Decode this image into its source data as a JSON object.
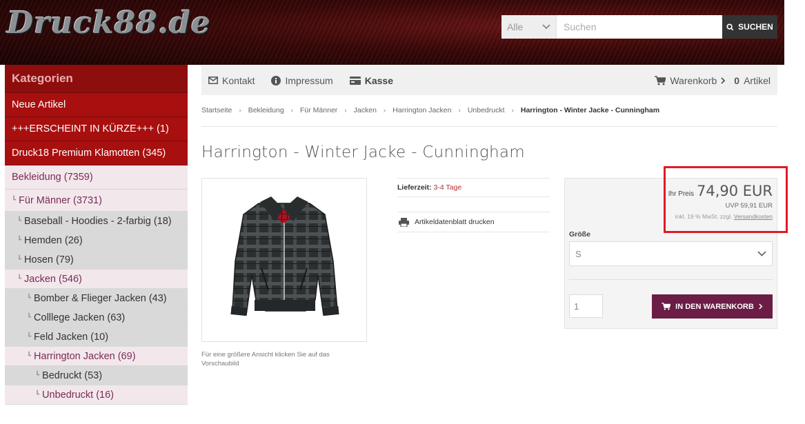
{
  "header": {
    "logo_text": "Druck88.de",
    "search": {
      "scope_label": "Alle",
      "placeholder": "Suchen",
      "button_label": "SUCHEN"
    }
  },
  "sidebar": {
    "heading": "Kategorien",
    "items": [
      {
        "label": "Neue Artikel"
      },
      {
        "label": "+++ERSCHEINT IN KÜRZE+++ (1)"
      },
      {
        "label": "Druck18 Premium Klamotten (345)"
      },
      {
        "label": "Bekleidung (7359)"
      },
      {
        "label": "Für Männer (3731)"
      },
      {
        "label": "Baseball - Hoodies - 2-farbig (18)"
      },
      {
        "label": "Hemden (26)"
      },
      {
        "label": "Hosen (79)"
      },
      {
        "label": "Jacken (546)"
      },
      {
        "label": "Bomber & Flieger Jacken (43)"
      },
      {
        "label": "Colllege Jacken (63)"
      },
      {
        "label": "Feld Jacken (10)"
      },
      {
        "label": "Harrington Jacken (69)"
      },
      {
        "label": "Bedruckt (53)"
      },
      {
        "label": "Unbedruckt (16)"
      }
    ]
  },
  "topnav": {
    "kontakt": "Kontakt",
    "impressum": "Impressum",
    "kasse": "Kasse",
    "warenkorb": "Warenkorb",
    "cart_count": "0",
    "cart_unit": "Artikel"
  },
  "breadcrumb": [
    "Startseite",
    "Bekleidung",
    "Für Männer",
    "Jacken",
    "Harrington Jacken",
    "Unbedruckt",
    "Harrington - Winter Jacke - Cunningham"
  ],
  "product": {
    "title": "Harrington - Winter Jacke - Cunningham",
    "image_note": "Für eine größere Ansicht klicken Sie auf das Vorschaubild",
    "delivery_label": "Lieferzeit:",
    "delivery_value": "3-4 Tage",
    "datasheet_label": "Artikeldatenblatt drucken",
    "price_label": "Ihr Preis",
    "price": "74,90 EUR",
    "uvp": "UVP 59,91 EUR",
    "tax_note": "inkl. 19 % MwSt. zzgl.",
    "shipping_link": "Versandkosten",
    "size_label": "Größe",
    "size_value": "S",
    "quantity": "1",
    "cart_button": "IN DEN WARENKORB"
  },
  "colors": {
    "sidebar_red": "#a80f0f",
    "cart_button": "#6b1d45",
    "highlight_box": "#e01b24"
  }
}
